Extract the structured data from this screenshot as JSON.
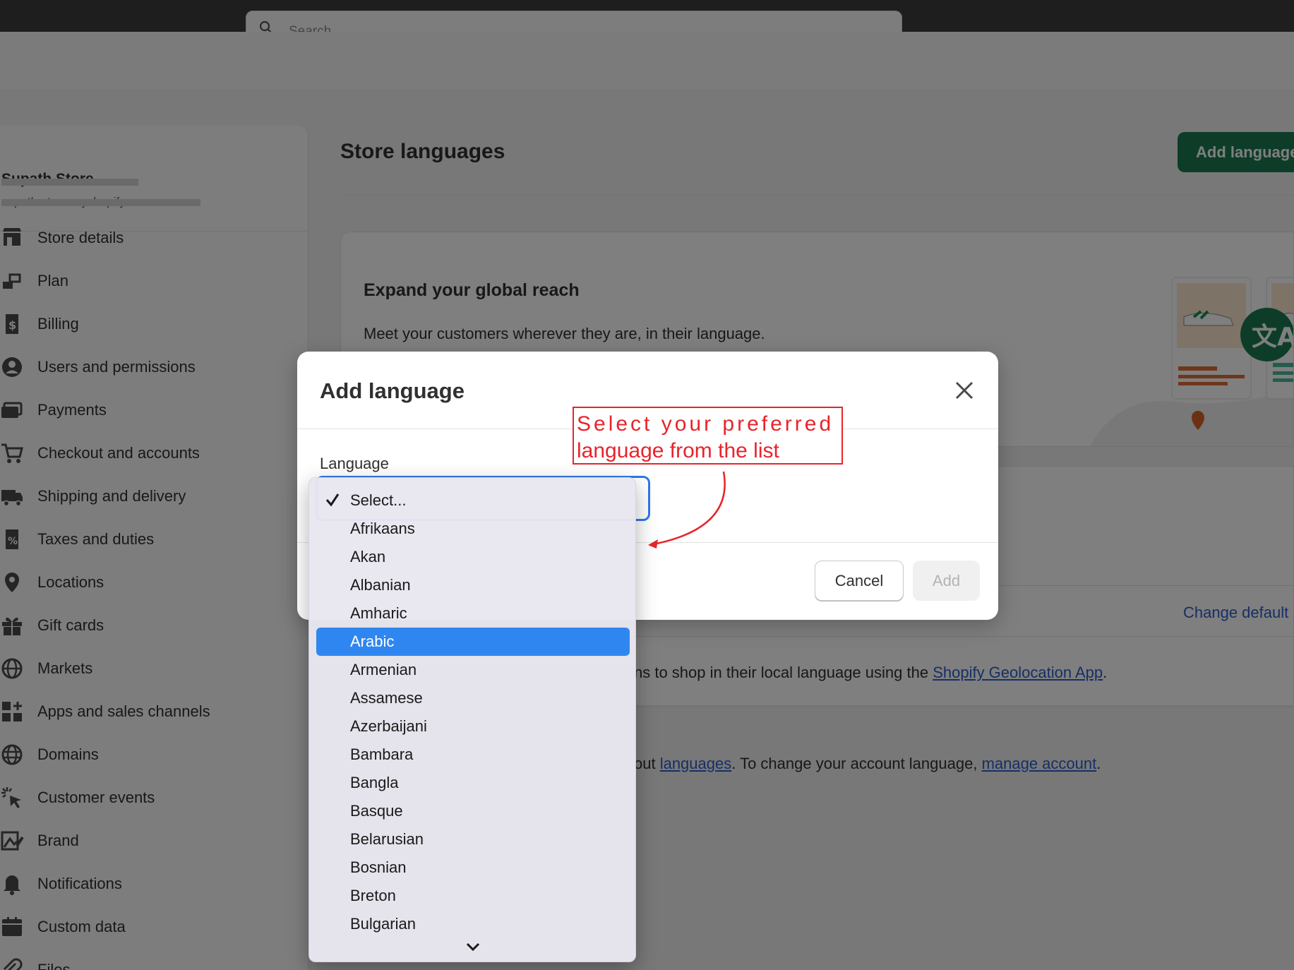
{
  "topbar": {
    "search_placeholder": "Search"
  },
  "store": {
    "name": "Supath Store",
    "url": "supath-store.myshopify.com"
  },
  "sidebar": {
    "items": [
      {
        "label": "Store details",
        "icon": "store-icon"
      },
      {
        "label": "Plan",
        "icon": "plan-icon"
      },
      {
        "label": "Billing",
        "icon": "billing-icon"
      },
      {
        "label": "Users and permissions",
        "icon": "user-icon"
      },
      {
        "label": "Payments",
        "icon": "payments-icon"
      },
      {
        "label": "Checkout and accounts",
        "icon": "cart-icon"
      },
      {
        "label": "Shipping and delivery",
        "icon": "truck-icon"
      },
      {
        "label": "Taxes and duties",
        "icon": "tax-icon"
      },
      {
        "label": "Locations",
        "icon": "location-pin-icon"
      },
      {
        "label": "Gift cards",
        "icon": "gift-icon"
      },
      {
        "label": "Markets",
        "icon": "globe-markets-icon"
      },
      {
        "label": "Apps and sales channels",
        "icon": "apps-icon"
      },
      {
        "label": "Domains",
        "icon": "globe-icon"
      },
      {
        "label": "Customer events",
        "icon": "cursor-click-icon"
      },
      {
        "label": "Brand",
        "icon": "brand-icon"
      },
      {
        "label": "Notifications",
        "icon": "bell-icon"
      },
      {
        "label": "Custom data",
        "icon": "custom-data-icon"
      },
      {
        "label": "Files",
        "icon": "paperclip-icon"
      }
    ]
  },
  "main": {
    "title": "Store languages",
    "add_language_button": "Add language",
    "banner": {
      "title": "Expand your global reach",
      "text": "Meet your customers wherever they are, in their language."
    },
    "change_default_link": "Change default",
    "geo": {
      "text_before": "ns to shop in their local language using the ",
      "link": "Shopify Geolocation App",
      "text_after": "."
    },
    "learn": {
      "text_before": "out ",
      "link1": "languages",
      "text_middle": ". To change your account language, ",
      "link2": "manage account",
      "text_after": "."
    }
  },
  "modal": {
    "title": "Add language",
    "field_label": "Language",
    "cancel": "Cancel",
    "add": "Add"
  },
  "annotation": {
    "line1": "Select your preferred",
    "line2": "language from the list",
    "color": "#e8242b"
  },
  "dropdown": {
    "selected_index": 5,
    "options": [
      "Select...",
      "Afrikaans",
      "Akan",
      "Albanian",
      "Amharic",
      "Arabic",
      "Armenian",
      "Assamese",
      "Azerbaijani",
      "Bambara",
      "Bangla",
      "Basque",
      "Belarusian",
      "Bosnian",
      "Breton",
      "Bulgarian"
    ],
    "highlight_color": "#2f86f0"
  },
  "colors": {
    "primary_button": "#1a7a52",
    "link": "#2c5fc8",
    "focus": "#2f79e8"
  }
}
